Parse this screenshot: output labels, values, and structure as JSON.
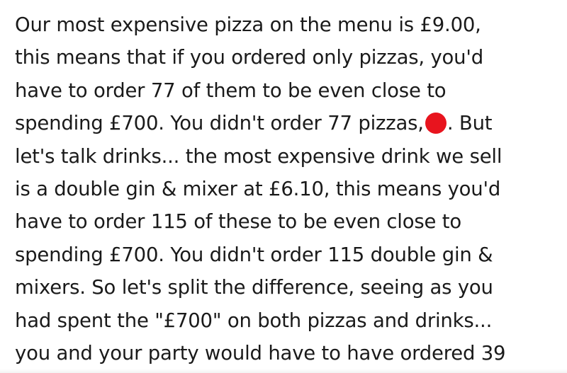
{
  "paragraph": {
    "lines": [
      "Our most expensive pizza on the menu is £9.00,",
      "this means that if you ordered only pizzas, you'd",
      "have to order 77 of them to be even close to",
      "spending £700. You didn't order 77 pizzas,",
      ". But",
      "let's talk drinks... the most expensive drink we sell",
      "is a double gin & mixer at £6.10, this means you'd",
      "have to order 115 of these to be even close to",
      "spending £700. You didn't order 115 double gin &",
      "mixers. So let's split the difference, seeing as you",
      "had spent the \"£700\" on both pizzas and drinks...",
      "you and your party would have to have ordered 39"
    ],
    "redaction_color": "#e8141e"
  }
}
